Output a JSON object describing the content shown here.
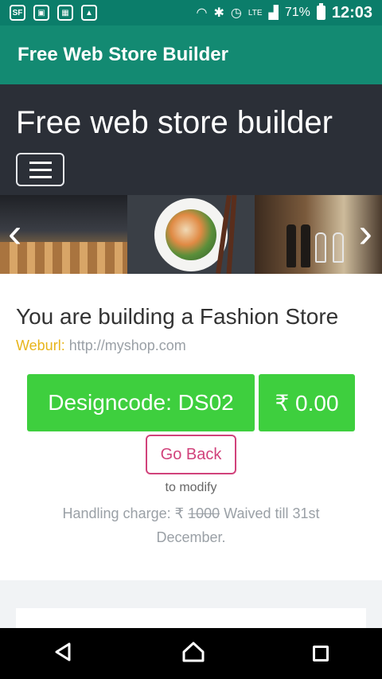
{
  "status_bar": {
    "icons": [
      "sf-icon",
      "sim-icon",
      "gallery-icon",
      "image-icon",
      "wifi-icon",
      "bluetooth-icon",
      "alarm-icon",
      "signal-icon",
      "battery-icon"
    ],
    "network": "LTE",
    "battery": "71%",
    "time": "12:03"
  },
  "app_bar": {
    "title": "Free Web Store Builder"
  },
  "hero": {
    "title": "Free web store builder"
  },
  "carousel": {
    "prev": "‹",
    "next": "›"
  },
  "main": {
    "heading": "You are building a Fashion Store",
    "weburl_label": "Weburl:",
    "weburl_value": "http://myshop.com",
    "design_code": "Designcode: DS02",
    "price": "₹ 0.00",
    "go_back": "Go Back",
    "modify_text": "to modify",
    "handling_prefix": "Handling charge: ₹",
    "handling_old": "1000",
    "handling_suffix": "Waived till 31st December."
  },
  "colors": {
    "status_bar": "#0b7d6a",
    "app_bar": "#138a72",
    "hero": "#2b2f37",
    "button_green": "#3ecf3e",
    "go_back": "#d1427b",
    "weburl_label": "#e8b51b"
  }
}
